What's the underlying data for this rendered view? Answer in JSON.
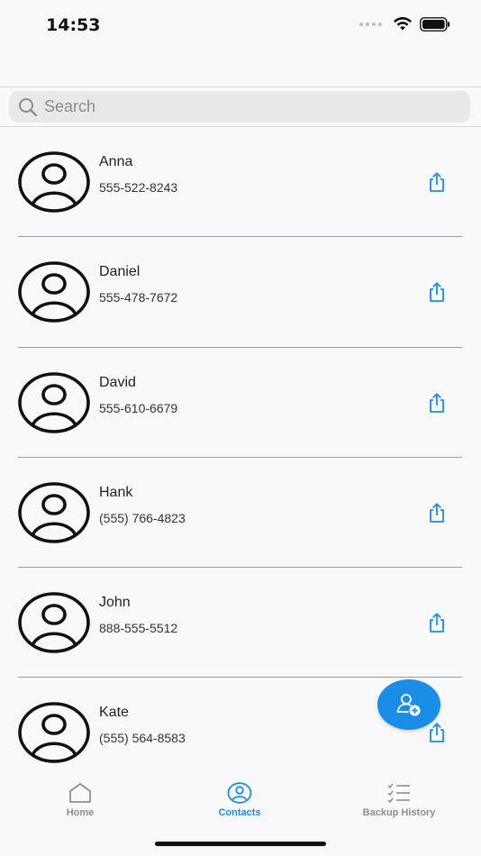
{
  "status_bar": {
    "time": "14:53"
  },
  "search": {
    "placeholder": "Search"
  },
  "contacts": [
    {
      "name": "Anna",
      "phone": "555-522-8243"
    },
    {
      "name": "Daniel",
      "phone": "555-478-7672"
    },
    {
      "name": "David",
      "phone": "555-610-6679"
    },
    {
      "name": "Hank",
      "phone": "(555) 766-4823"
    },
    {
      "name": "John",
      "phone": "888-555-5512"
    },
    {
      "name": "Kate",
      "phone": "(555) 564-8583"
    }
  ],
  "tabs": [
    {
      "label": "Home",
      "icon": "house-icon",
      "active": false
    },
    {
      "label": "Contacts",
      "icon": "person-circle-icon",
      "active": true
    },
    {
      "label": "Backup History",
      "icon": "checklist-icon",
      "active": false
    }
  ],
  "colors": {
    "accent": "#1a8ee6",
    "divider": "#8fa1a6",
    "inactive": "#8e8e93"
  }
}
